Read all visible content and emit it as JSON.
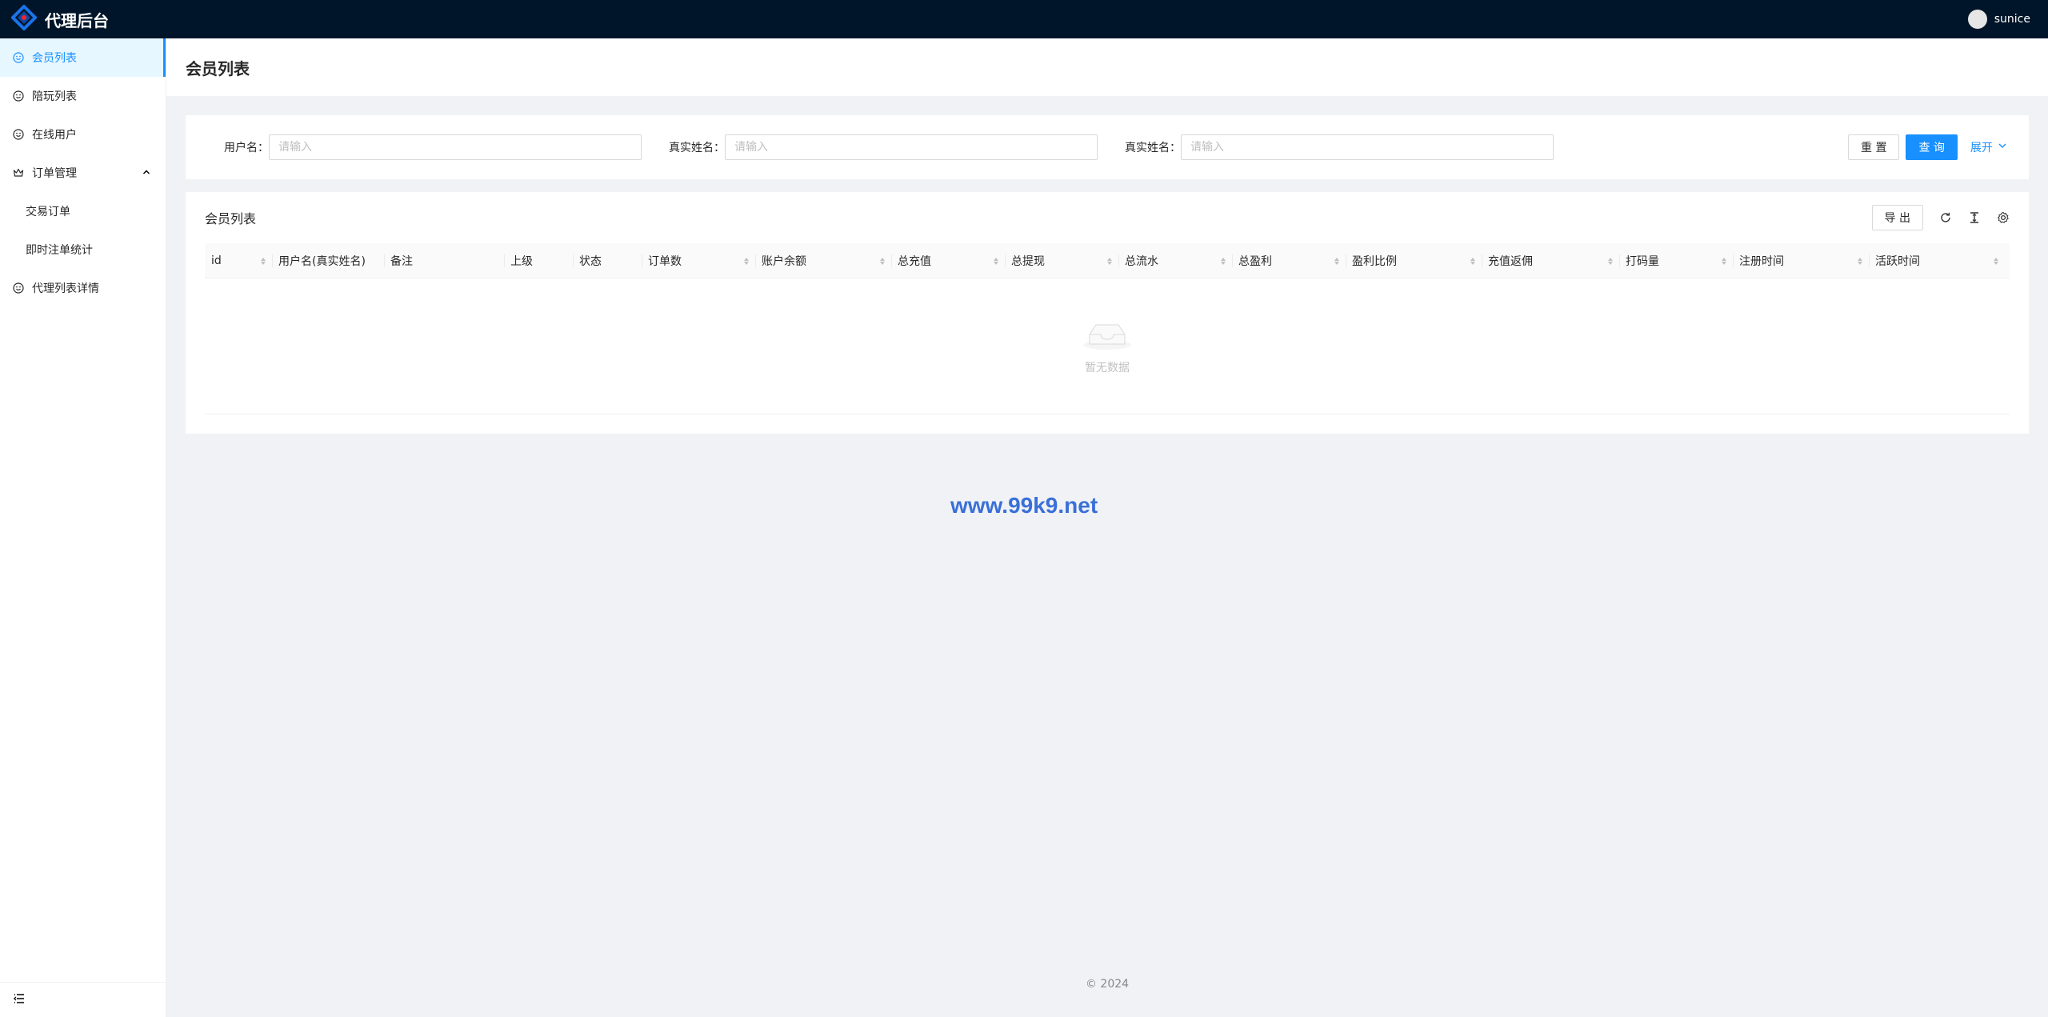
{
  "app": {
    "title": "代理后台"
  },
  "user": {
    "name": "sunice"
  },
  "sidebar": {
    "items": [
      {
        "label": "会员列表",
        "icon": "smile-icon",
        "active": true
      },
      {
        "label": "陪玩列表",
        "icon": "smile-icon"
      },
      {
        "label": "在线用户",
        "icon": "smile-icon"
      },
      {
        "label": "订单管理",
        "icon": "crown-icon",
        "expanded": true
      },
      {
        "label": "交易订单",
        "sub": true
      },
      {
        "label": "即时注单统计",
        "sub": true
      },
      {
        "label": "代理列表详情",
        "icon": "smile-icon"
      }
    ]
  },
  "page": {
    "title": "会员列表"
  },
  "search": {
    "fields": [
      {
        "label": "用户名：",
        "placeholder": "请输入",
        "value": ""
      },
      {
        "label": "真实姓名：",
        "placeholder": "请输入",
        "value": ""
      },
      {
        "label": "真实姓名：",
        "placeholder": "请输入",
        "value": ""
      }
    ],
    "reset_label": "重 置",
    "query_label": "查 询",
    "expand_label": "展开"
  },
  "table": {
    "title": "会员列表",
    "export_label": "导 出",
    "columns": [
      {
        "label": "id",
        "sortable": true
      },
      {
        "label": "用户名(真实姓名)",
        "sortable": false
      },
      {
        "label": "备注",
        "sortable": false
      },
      {
        "label": "上级",
        "sortable": false
      },
      {
        "label": "状态",
        "sortable": false
      },
      {
        "label": "订单数",
        "sortable": true
      },
      {
        "label": "账户余额",
        "sortable": true
      },
      {
        "label": "总充值",
        "sortable": true
      },
      {
        "label": "总提现",
        "sortable": true
      },
      {
        "label": "总流水",
        "sortable": true
      },
      {
        "label": "总盈利",
        "sortable": true
      },
      {
        "label": "盈利比例",
        "sortable": true
      },
      {
        "label": "充值返佣",
        "sortable": true
      },
      {
        "label": "打码量",
        "sortable": true
      },
      {
        "label": "注册时间",
        "sortable": true
      },
      {
        "label": "活跃时间",
        "sortable": true
      }
    ],
    "rows": [],
    "empty_text": "暂无数据"
  },
  "watermark": "www.99k9.net",
  "footer": {
    "copyright": "2024"
  },
  "colors": {
    "topbar": "#001529",
    "primary": "#1890ff",
    "background": "#f0f2f5"
  }
}
